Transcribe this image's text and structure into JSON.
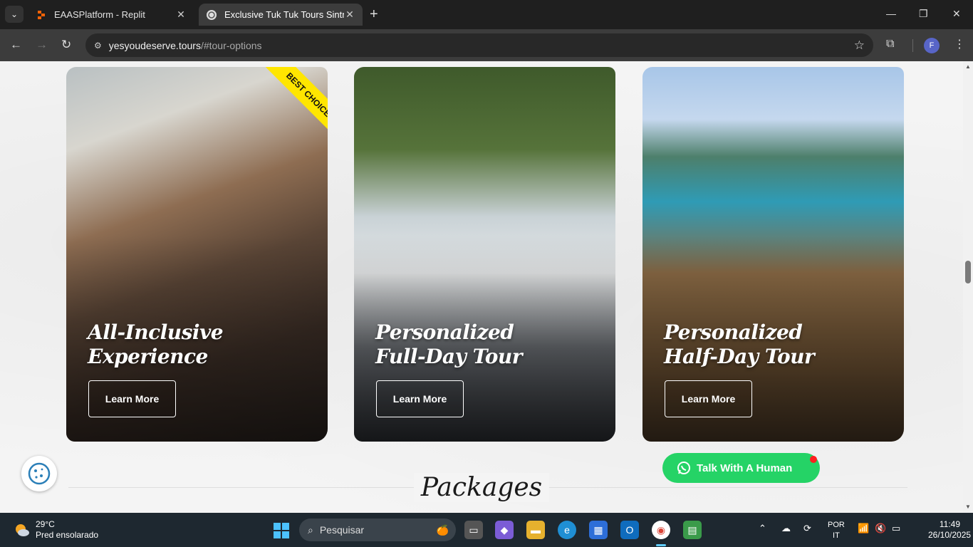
{
  "browser": {
    "tabs": [
      {
        "title": "EAASPlatform - Replit",
        "active": false
      },
      {
        "title": "Exclusive Tuk Tuk Tours Sintra &",
        "active": true
      }
    ],
    "new_tab": "+",
    "url_host": "yesyoudeserve.tours",
    "url_path": "/#tour-options",
    "profile_initial": "F"
  },
  "page": {
    "cards": [
      {
        "title_line1": "All-Inclusive",
        "title_line2": "Experience",
        "button": "Learn More",
        "ribbon": "BEST CHOICE"
      },
      {
        "title_line1": "Personalized",
        "title_line2": "Full-Day Tour",
        "button": "Learn More"
      },
      {
        "title_line1": "Personalized",
        "title_line2": "Half-Day Tour",
        "button": "Learn More"
      }
    ],
    "whatsapp_label": "Talk With A Human",
    "section_heading": "Packages"
  },
  "taskbar": {
    "temperature": "29°C",
    "weather": "Pred ensolarado",
    "search_placeholder": "Pesquisar",
    "lang_line1": "POR",
    "lang_line2": "IT",
    "time": "11:49",
    "date": "26/10/2025"
  },
  "colors": {
    "whatsapp": "#25d366",
    "ribbon": "#ffe600",
    "accent_active": "#60cdff"
  }
}
